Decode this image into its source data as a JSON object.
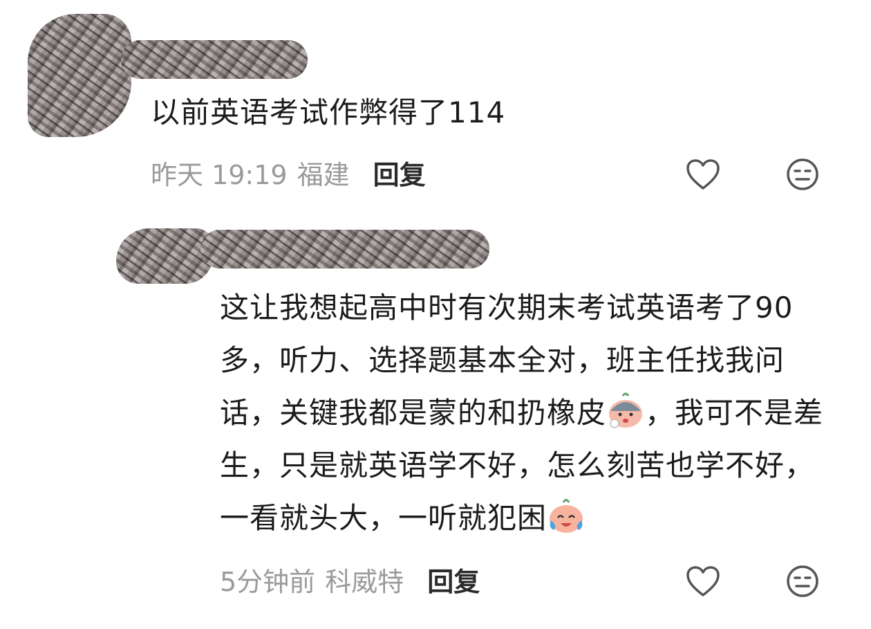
{
  "comments": [
    {
      "text": "以前英语考试作弊得了114",
      "time": "昨天 19:19",
      "location": "福建",
      "reply_label": "回复"
    },
    {
      "text_parts": [
        "这让我想起高中时有次期末考试英语考了90多，听力、选择题基本全对，班主任找我问话，关键我都是蒙的和扔橡皮",
        "，我可不是差生，只是就英语学不好，怎么刻苦也学不好，一看就头大，一听就犯困"
      ],
      "time": "5分钟前",
      "location": "科威特",
      "reply_label": "回复"
    }
  ],
  "icons": {
    "like": "heart-outline-icon",
    "dislike": "neutral-face-icon",
    "emoji_1": "worried-face-emoji",
    "emoji_2": "laughing-tears-emoji"
  },
  "colors": {
    "text": "#1b1b1b",
    "meta": "#9a9a9a",
    "reply": "#2a2a2a",
    "icon": "#555555"
  }
}
